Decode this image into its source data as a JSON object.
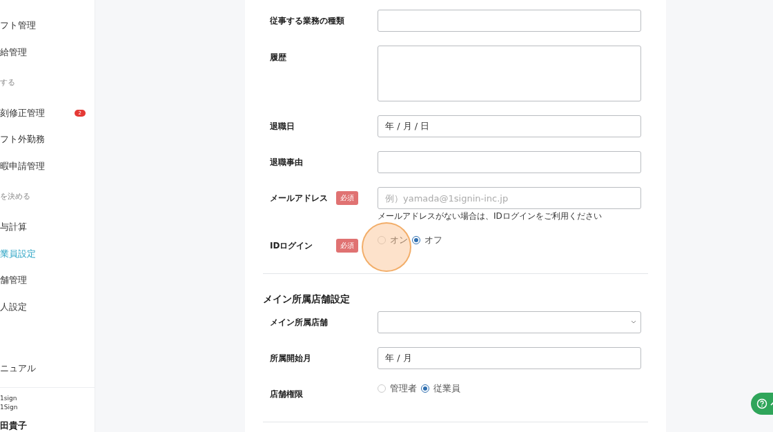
{
  "sidebar": {
    "items": [
      {
        "kind": "link",
        "label": "フト管理",
        "selected": false
      },
      {
        "kind": "link",
        "label": "給管理",
        "selected": false
      },
      {
        "kind": "section",
        "label": "する"
      },
      {
        "kind": "link",
        "label": "刻修正管理",
        "selected": false,
        "badge": "2"
      },
      {
        "kind": "link",
        "label": "フト外勤務",
        "selected": false
      },
      {
        "kind": "link",
        "label": "暇申請管理",
        "selected": false
      },
      {
        "kind": "section",
        "label": "を決める"
      },
      {
        "kind": "link",
        "label": "与計算",
        "selected": false
      },
      {
        "kind": "link",
        "label": "業員設定",
        "selected": true
      },
      {
        "kind": "link",
        "label": "舗管理",
        "selected": false
      },
      {
        "kind": "link",
        "label": "人設定",
        "selected": false
      },
      {
        "kind": "gap"
      },
      {
        "kind": "link",
        "label": "ニュアル",
        "selected": false
      }
    ],
    "account": {
      "company": "1sign",
      "workspace": "1Sign",
      "user": "田貴子"
    }
  },
  "form": {
    "groups": [
      {
        "fields": [
          {
            "kind": "text",
            "label": "従事する業務の種類"
          },
          {
            "kind": "textarea",
            "label": "履歴"
          },
          {
            "kind": "text",
            "label": "退職日",
            "value": "年 / 月 / 日"
          },
          {
            "kind": "text",
            "label": "退職事由"
          },
          {
            "kind": "text",
            "label": "メールアドレス",
            "required": "必須",
            "placeholder": "例）yamada@1signin-inc.jp",
            "hint": "メールアドレスがない場合は、IDログインをご利用ください"
          },
          {
            "kind": "radio",
            "label": "IDログイン",
            "required": "必須",
            "options": [
              {
                "label": "オン",
                "selected": false
              },
              {
                "label": "オフ",
                "selected": true
              }
            ]
          }
        ]
      },
      {
        "title": "メイン所属店舗設定",
        "fields": [
          {
            "kind": "select",
            "label": "メイン所属店舗"
          },
          {
            "kind": "text",
            "label": "所属開始月",
            "value": "年 / 月"
          },
          {
            "kind": "radio",
            "label": "店舗権限",
            "options": [
              {
                "label": "管理者",
                "selected": false
              },
              {
                "label": "従業員",
                "selected": true
              }
            ]
          }
        ]
      }
    ]
  }
}
